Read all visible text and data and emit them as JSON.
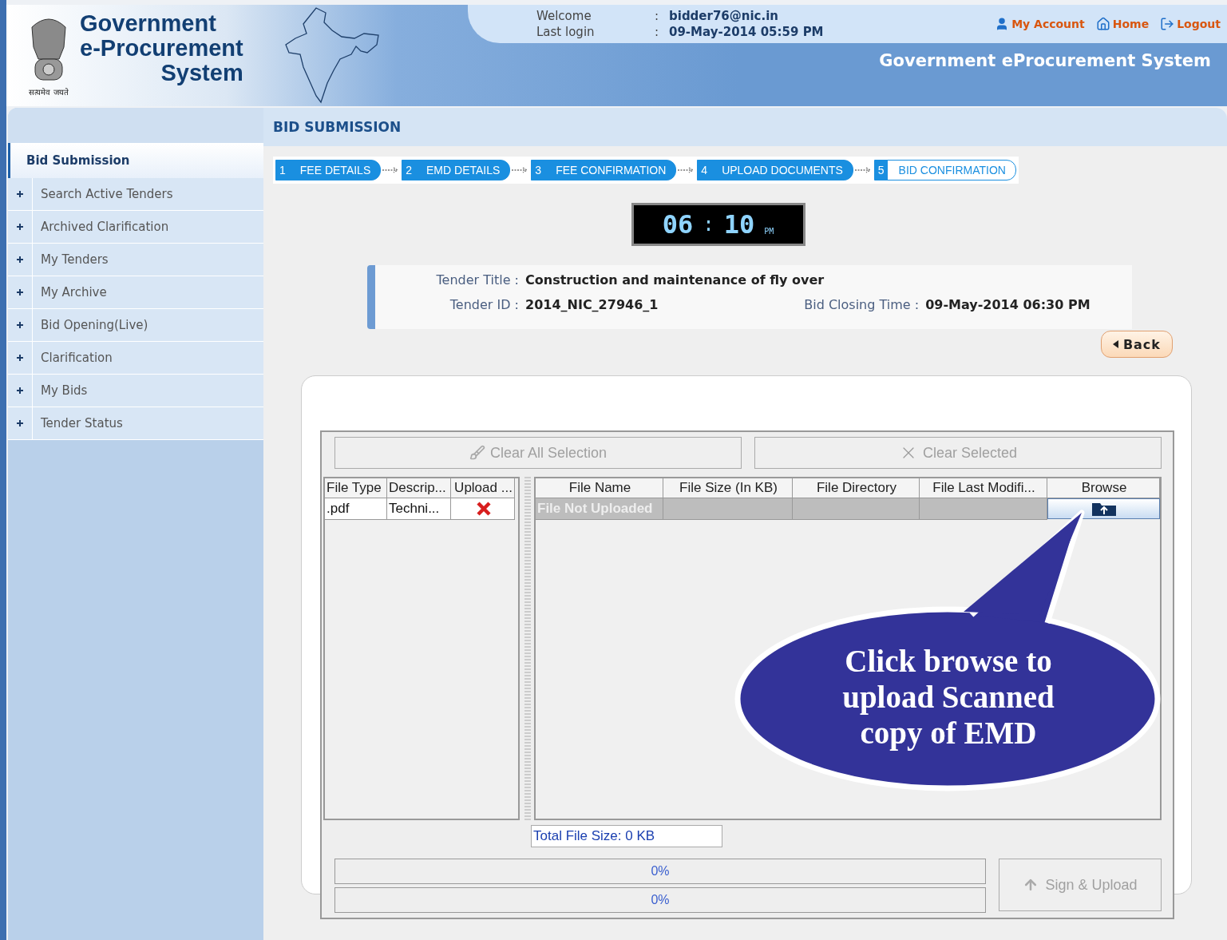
{
  "header": {
    "logo_lines": [
      "Government",
      "e-Procurement",
      "System"
    ],
    "motto": "सत्यमेव जयते",
    "user_info": [
      {
        "label": "Welcome",
        "separator": ":",
        "value": "bidder76@nic.in"
      },
      {
        "label": "Last login",
        "separator": ":",
        "value": "09-May-2014 05:59 PM"
      }
    ],
    "links": [
      {
        "kind": "account",
        "label": "My Account"
      },
      {
        "kind": "home",
        "label": "Home"
      },
      {
        "kind": "logout",
        "label": "Logout"
      }
    ],
    "system_name": "Government eProcurement System"
  },
  "sidebar": {
    "title": "Bid Submission",
    "items": [
      {
        "label": "Search Active Tenders"
      },
      {
        "label": "Archived Clarification"
      },
      {
        "label": "My Tenders"
      },
      {
        "label": "My Archive"
      },
      {
        "label": "Bid Opening(Live)"
      },
      {
        "label": "Clarification"
      },
      {
        "label": "My Bids"
      },
      {
        "label": "Tender Status"
      }
    ]
  },
  "page_title": "BID SUBMISSION",
  "steps": [
    {
      "number": "1",
      "label": "FEE DETAILS",
      "done": true
    },
    {
      "number": "2",
      "label": "EMD DETAILS",
      "done": true
    },
    {
      "number": "3",
      "label": "FEE CONFIRMATION",
      "done": true
    },
    {
      "number": "4",
      "label": "UPLOAD DOCUMENTS",
      "done": true
    },
    {
      "number": "5",
      "label": "BID CONFIRMATION",
      "done": false
    }
  ],
  "clock": {
    "hours": "06",
    "separator": ":",
    "minutes": "10",
    "period": "PM"
  },
  "tender": {
    "title_label": "Tender Title :",
    "title": "Construction and maintenance of fly over",
    "id_label": "Tender ID :",
    "id": "2014_NIC_27946_1",
    "closing_label": "Bid Closing Time :",
    "closing": "09-May-2014 06:30 PM"
  },
  "back_button": "Back",
  "applet": {
    "buttons": [
      {
        "kind": "clear-all",
        "label": "Clear All Selection",
        "disabled": true
      },
      {
        "kind": "clear-selected",
        "label": "Clear Selected",
        "disabled": true
      }
    ],
    "file_types": {
      "columns": [
        "File Type",
        "Descrip...",
        "Upload ..."
      ],
      "rows": [
        {
          "file_type": ".pdf",
          "description": "Techni...",
          "uploaded": false
        }
      ]
    },
    "files": {
      "columns": [
        "File Name",
        "File Size (In KB)",
        "File Directory",
        "File Last Modifi...",
        "Browse"
      ],
      "rows": [
        {
          "file_name": "File Not Uploaded"
        }
      ]
    },
    "total_size": "Total File Size: 0 KB",
    "progress": [
      {
        "level": 0,
        "reading": "0%"
      },
      {
        "level": 0,
        "reading": "0%"
      }
    ],
    "sign_button": {
      "label": "Sign & Upload",
      "disabled": true
    }
  },
  "callout": "Click browse to upload Scanned copy of EMD"
}
